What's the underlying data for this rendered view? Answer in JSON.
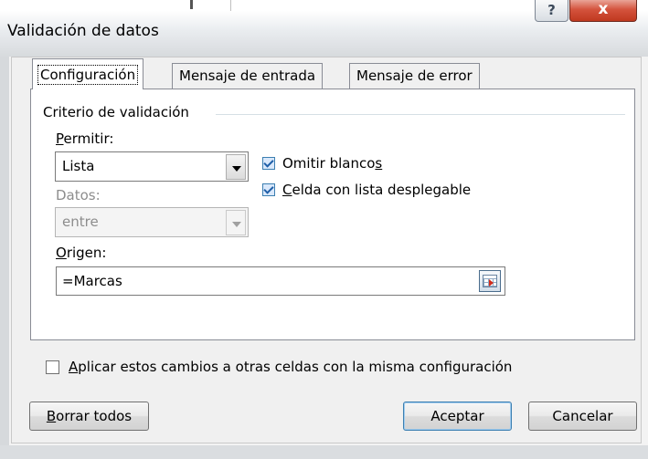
{
  "window": {
    "title": "Validación de datos",
    "help_label": "?",
    "close_label": "x"
  },
  "tabs": [
    {
      "label": "Configuración",
      "active": true
    },
    {
      "label": "Mensaje de entrada",
      "active": false
    },
    {
      "label": "Mensaje de error",
      "active": false
    }
  ],
  "settings": {
    "group_label": "Criterio de validación",
    "allow": {
      "label_u": "P",
      "label_rest": "ermitir:",
      "value": "Lista"
    },
    "data": {
      "label": "Datos:",
      "value": "entre"
    },
    "ignore_blank": {
      "label_pre": "Omitir blanco",
      "label_u": "s",
      "checked": true
    },
    "in_cell_dropdown": {
      "label_u": "C",
      "label_rest": "elda con lista desplegable",
      "checked": true
    },
    "source": {
      "label_u": "O",
      "label_rest": "rigen:",
      "value": "=Marcas"
    },
    "apply_all": {
      "label_u": "A",
      "label_rest": "plicar estos cambios a otras celdas con la misma configuración",
      "checked": false
    }
  },
  "buttons": {
    "clear_u": "B",
    "clear_rest": "orrar todos",
    "ok": "Aceptar",
    "cancel": "Cancelar"
  },
  "colors": {
    "close_button": "#c73b22",
    "checkbox_check": "#1f5fa8",
    "default_button_border": "#3c7fb1"
  }
}
